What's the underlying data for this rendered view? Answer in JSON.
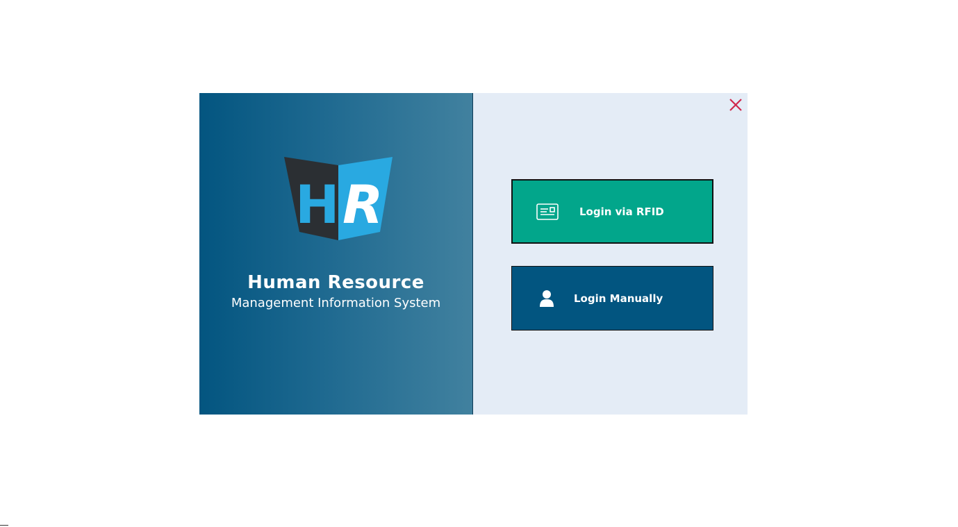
{
  "brand": {
    "logo_letters": "HR",
    "title": "Human Resource",
    "subtitle": "Management Information System"
  },
  "actions": {
    "rfid_label": "Login via RFID",
    "manual_label": "Login Manually"
  },
  "icons": {
    "close": "close-icon",
    "rfid": "id-card-icon",
    "manual": "user-icon"
  },
  "colors": {
    "panel_gradient_start": "#035580",
    "panel_gradient_end": "#41819f",
    "right_panel_bg": "#e4ecf6",
    "rfid_button": "#02a68b",
    "manual_button": "#025580",
    "close_icon": "#d0284c",
    "logo_dark": "#2b2f33",
    "logo_light": "#29a9e1"
  }
}
